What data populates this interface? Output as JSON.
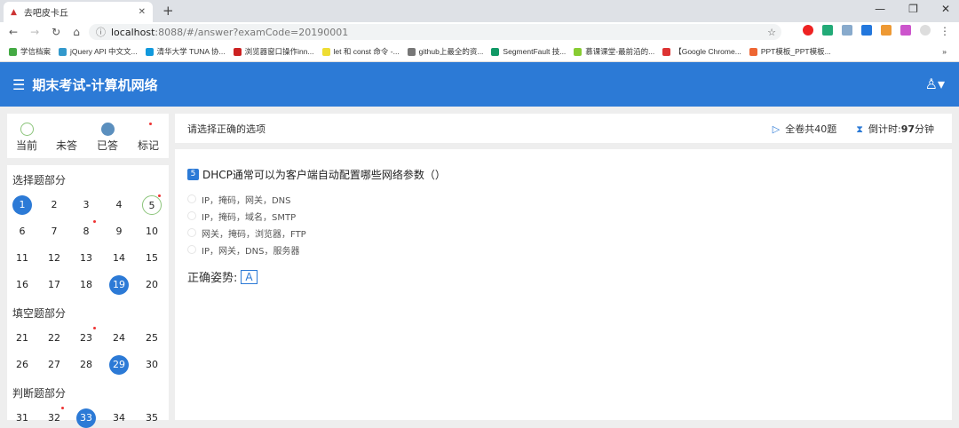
{
  "browser": {
    "tab_title": "去吧皮卡丘",
    "url_host": "localhost",
    "url_rest": ":8088/#/answer?examCode=20190001",
    "bookmarks": [
      "学信档案",
      "jQuery API 中文文...",
      "清华大学 TUNA 协...",
      "浏览器窗口操作inn...",
      "let 和 const 命令 -...",
      "github上最全的资...",
      "SegmentFault 技...",
      "慕课课堂-最前沿的...",
      "【Google Chrome...",
      "PPT模板_PPT模板..."
    ]
  },
  "header": {
    "title": "期末考试-计算机网络"
  },
  "legend": {
    "current": "当前",
    "unanswered": "未答",
    "answered": "已答",
    "marked": "标记"
  },
  "sections": [
    {
      "title": "选择题部分",
      "questions": [
        {
          "n": "1",
          "answered": true
        },
        {
          "n": "2"
        },
        {
          "n": "3"
        },
        {
          "n": "4"
        },
        {
          "n": "5",
          "current": true,
          "marked": true
        },
        {
          "n": "6"
        },
        {
          "n": "7"
        },
        {
          "n": "8",
          "marked": true
        },
        {
          "n": "9"
        },
        {
          "n": "10"
        },
        {
          "n": "11"
        },
        {
          "n": "12"
        },
        {
          "n": "13"
        },
        {
          "n": "14"
        },
        {
          "n": "15"
        },
        {
          "n": "16"
        },
        {
          "n": "17"
        },
        {
          "n": "18"
        },
        {
          "n": "19",
          "answered": true
        },
        {
          "n": "20"
        }
      ]
    },
    {
      "title": "填空题部分",
      "questions": [
        {
          "n": "21"
        },
        {
          "n": "22"
        },
        {
          "n": "23",
          "marked": true
        },
        {
          "n": "24"
        },
        {
          "n": "25"
        },
        {
          "n": "26"
        },
        {
          "n": "27"
        },
        {
          "n": "28"
        },
        {
          "n": "29",
          "answered": true
        },
        {
          "n": "30"
        }
      ]
    },
    {
      "title": "判断题部分",
      "questions": [
        {
          "n": "31"
        },
        {
          "n": "32",
          "marked": true
        },
        {
          "n": "33",
          "answered": true
        },
        {
          "n": "34"
        },
        {
          "n": "35"
        }
      ]
    }
  ],
  "topbar": {
    "instruction": "请选择正确的选项",
    "total": "全卷共40题",
    "countdown_label": "倒计时:",
    "countdown_value": "97",
    "countdown_unit": "分钟"
  },
  "question": {
    "number": "5",
    "text": "DHCP通常可以为客户端自动配置哪些网络参数（）",
    "options": [
      "IP，掩码，网关，DNS",
      "IP，掩码，域名，SMTP",
      "网关，掩码，浏览器，FTP",
      "IP，网关，DNS，服务器"
    ],
    "answer_label": "正确姿势:",
    "answer": "A"
  }
}
